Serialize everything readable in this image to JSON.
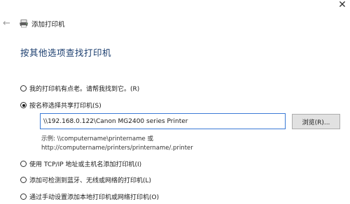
{
  "window": {
    "close_glyph": "✕",
    "back_glyph": "←",
    "title": "添加打印机"
  },
  "heading": "按其他选项查找打印机",
  "options": [
    {
      "label": "我的打印机有点老。请帮我找到它。(R)",
      "checked": false
    },
    {
      "label": "按名称选择共享打印机(S)",
      "checked": true
    },
    {
      "label": "使用 TCP/IP 地址或主机名添加打印机(I)",
      "checked": false
    },
    {
      "label": "添加可检测到蓝牙、无线或网络的打印机(L)",
      "checked": false
    },
    {
      "label": "通过手动设置添加本地打印机或网络打印机(O)",
      "checked": false
    }
  ],
  "shared_printer": {
    "value": "\\\\192.168.0.122\\Canon MG2400 series Printer",
    "browse_label": "浏览(R)...",
    "example_line1": "示例: \\\\computername\\printername 或",
    "example_line2": "http://computername/printers/printername/.printer"
  },
  "colors": {
    "heading": "#1a3d6e",
    "input_border": "#3c7bd6",
    "button_bg": "#e1e1e1"
  },
  "icons": {
    "back": "back-arrow-icon",
    "printer": "printer-icon",
    "close": "close-icon"
  }
}
